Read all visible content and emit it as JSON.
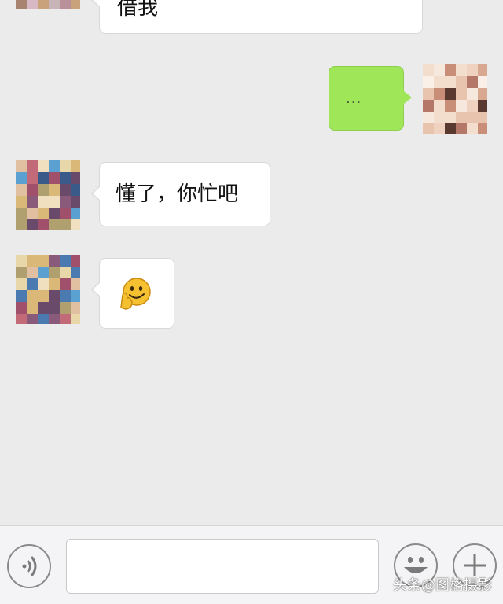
{
  "messages": [
    {
      "side": "left",
      "text": "借我"
    },
    {
      "side": "right",
      "text": "..."
    },
    {
      "side": "left",
      "text": "懂了，你忙吧"
    },
    {
      "side": "left",
      "emoji": "🤗"
    }
  ],
  "input": {
    "value": "",
    "placeholder": ""
  },
  "icons": {
    "voice": "voice-icon",
    "emoji": "smiley-face-icon",
    "more": "plus-icon"
  },
  "colors": {
    "background": "#ebebeb",
    "sent_bubble": "#9fe658",
    "received_bubble": "#ffffff"
  },
  "watermark": "头条@图格摄影"
}
